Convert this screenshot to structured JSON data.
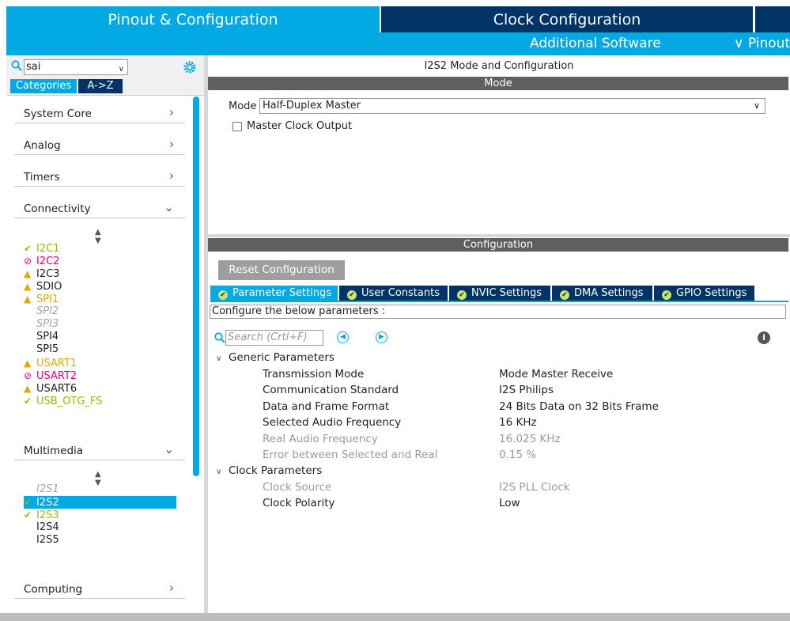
{
  "top": {
    "tab_pinout": "Pinout & Configuration",
    "tab_clock": "Clock Configuration",
    "additional_software": "Additional Software",
    "pinout_menu": "∨ Pinout"
  },
  "sidebar": {
    "search_value": "sai",
    "tab_categories": "Categories",
    "tab_az": "A->Z",
    "categories": [
      "System Core",
      "Analog",
      "Timers",
      "Connectivity",
      "Multimedia",
      "Computing"
    ],
    "connectivity_items": [
      {
        "label": "I2C1",
        "status": "ok"
      },
      {
        "label": "I2C2",
        "status": "error"
      },
      {
        "label": "I2C3",
        "status": "warning"
      },
      {
        "label": "SDIO",
        "status": "warning"
      },
      {
        "label": "SPI1",
        "status": "warning"
      },
      {
        "label": "SPI2",
        "status": "disabled"
      },
      {
        "label": "SPI3",
        "status": "disabled"
      },
      {
        "label": "SPI4",
        "status": "none"
      },
      {
        "label": "SPI5",
        "status": "none"
      },
      {
        "label": "USART1",
        "status": "warning"
      },
      {
        "label": "USART2",
        "status": "error"
      },
      {
        "label": "USART6",
        "status": "warning"
      },
      {
        "label": "USB_OTG_FS",
        "status": "ok"
      }
    ],
    "multimedia_items": [
      {
        "label": "I2S1",
        "status": "disabled"
      },
      {
        "label": "I2S2",
        "status": "ok-selected"
      },
      {
        "label": "I2S3",
        "status": "ok"
      },
      {
        "label": "I2S4",
        "status": "none"
      },
      {
        "label": "I2S5",
        "status": "none"
      }
    ]
  },
  "main": {
    "title": "I2S2 Mode and Configuration",
    "mode_header": "Mode",
    "mode_label": "Mode",
    "mode_value": "Half-Duplex Master",
    "master_clock_output": "Master Clock Output",
    "config_header": "Configuration",
    "reset_button": "Reset Configuration",
    "tabs": [
      "Parameter Settings",
      "User Constants",
      "NVIC Settings",
      "DMA Settings",
      "GPIO Settings"
    ],
    "hint": "Configure the below parameters :",
    "search_placeholder": "Search (Crtl+F)",
    "groups": [
      {
        "name": "Generic Parameters",
        "params": [
          {
            "name": "Transmission Mode",
            "value": "Mode Master Receive",
            "enabled": true
          },
          {
            "name": "Communication Standard",
            "value": "I2S Philips",
            "enabled": true
          },
          {
            "name": "Data and Frame Format",
            "value": "24 Bits Data on 32 Bits Frame",
            "enabled": true
          },
          {
            "name": "Selected Audio Frequency",
            "value": "16 KHz",
            "enabled": true
          },
          {
            "name": "Real Audio Frequency",
            "value": "16.025 KHz",
            "enabled": false
          },
          {
            "name": "Error between Selected and Real",
            "value": "0.15 %",
            "enabled": false
          }
        ]
      },
      {
        "name": "Clock Parameters",
        "params": [
          {
            "name": "Clock Source",
            "value": "I2S PLL Clock",
            "enabled": false
          },
          {
            "name": "Clock Polarity",
            "value": "Low",
            "enabled": true
          }
        ]
      }
    ]
  },
  "colors": {
    "accent": "#03a9e3",
    "navy": "#003466",
    "ok": "#8fbf00",
    "warning": "#e6a800",
    "error": "#e6007e"
  }
}
